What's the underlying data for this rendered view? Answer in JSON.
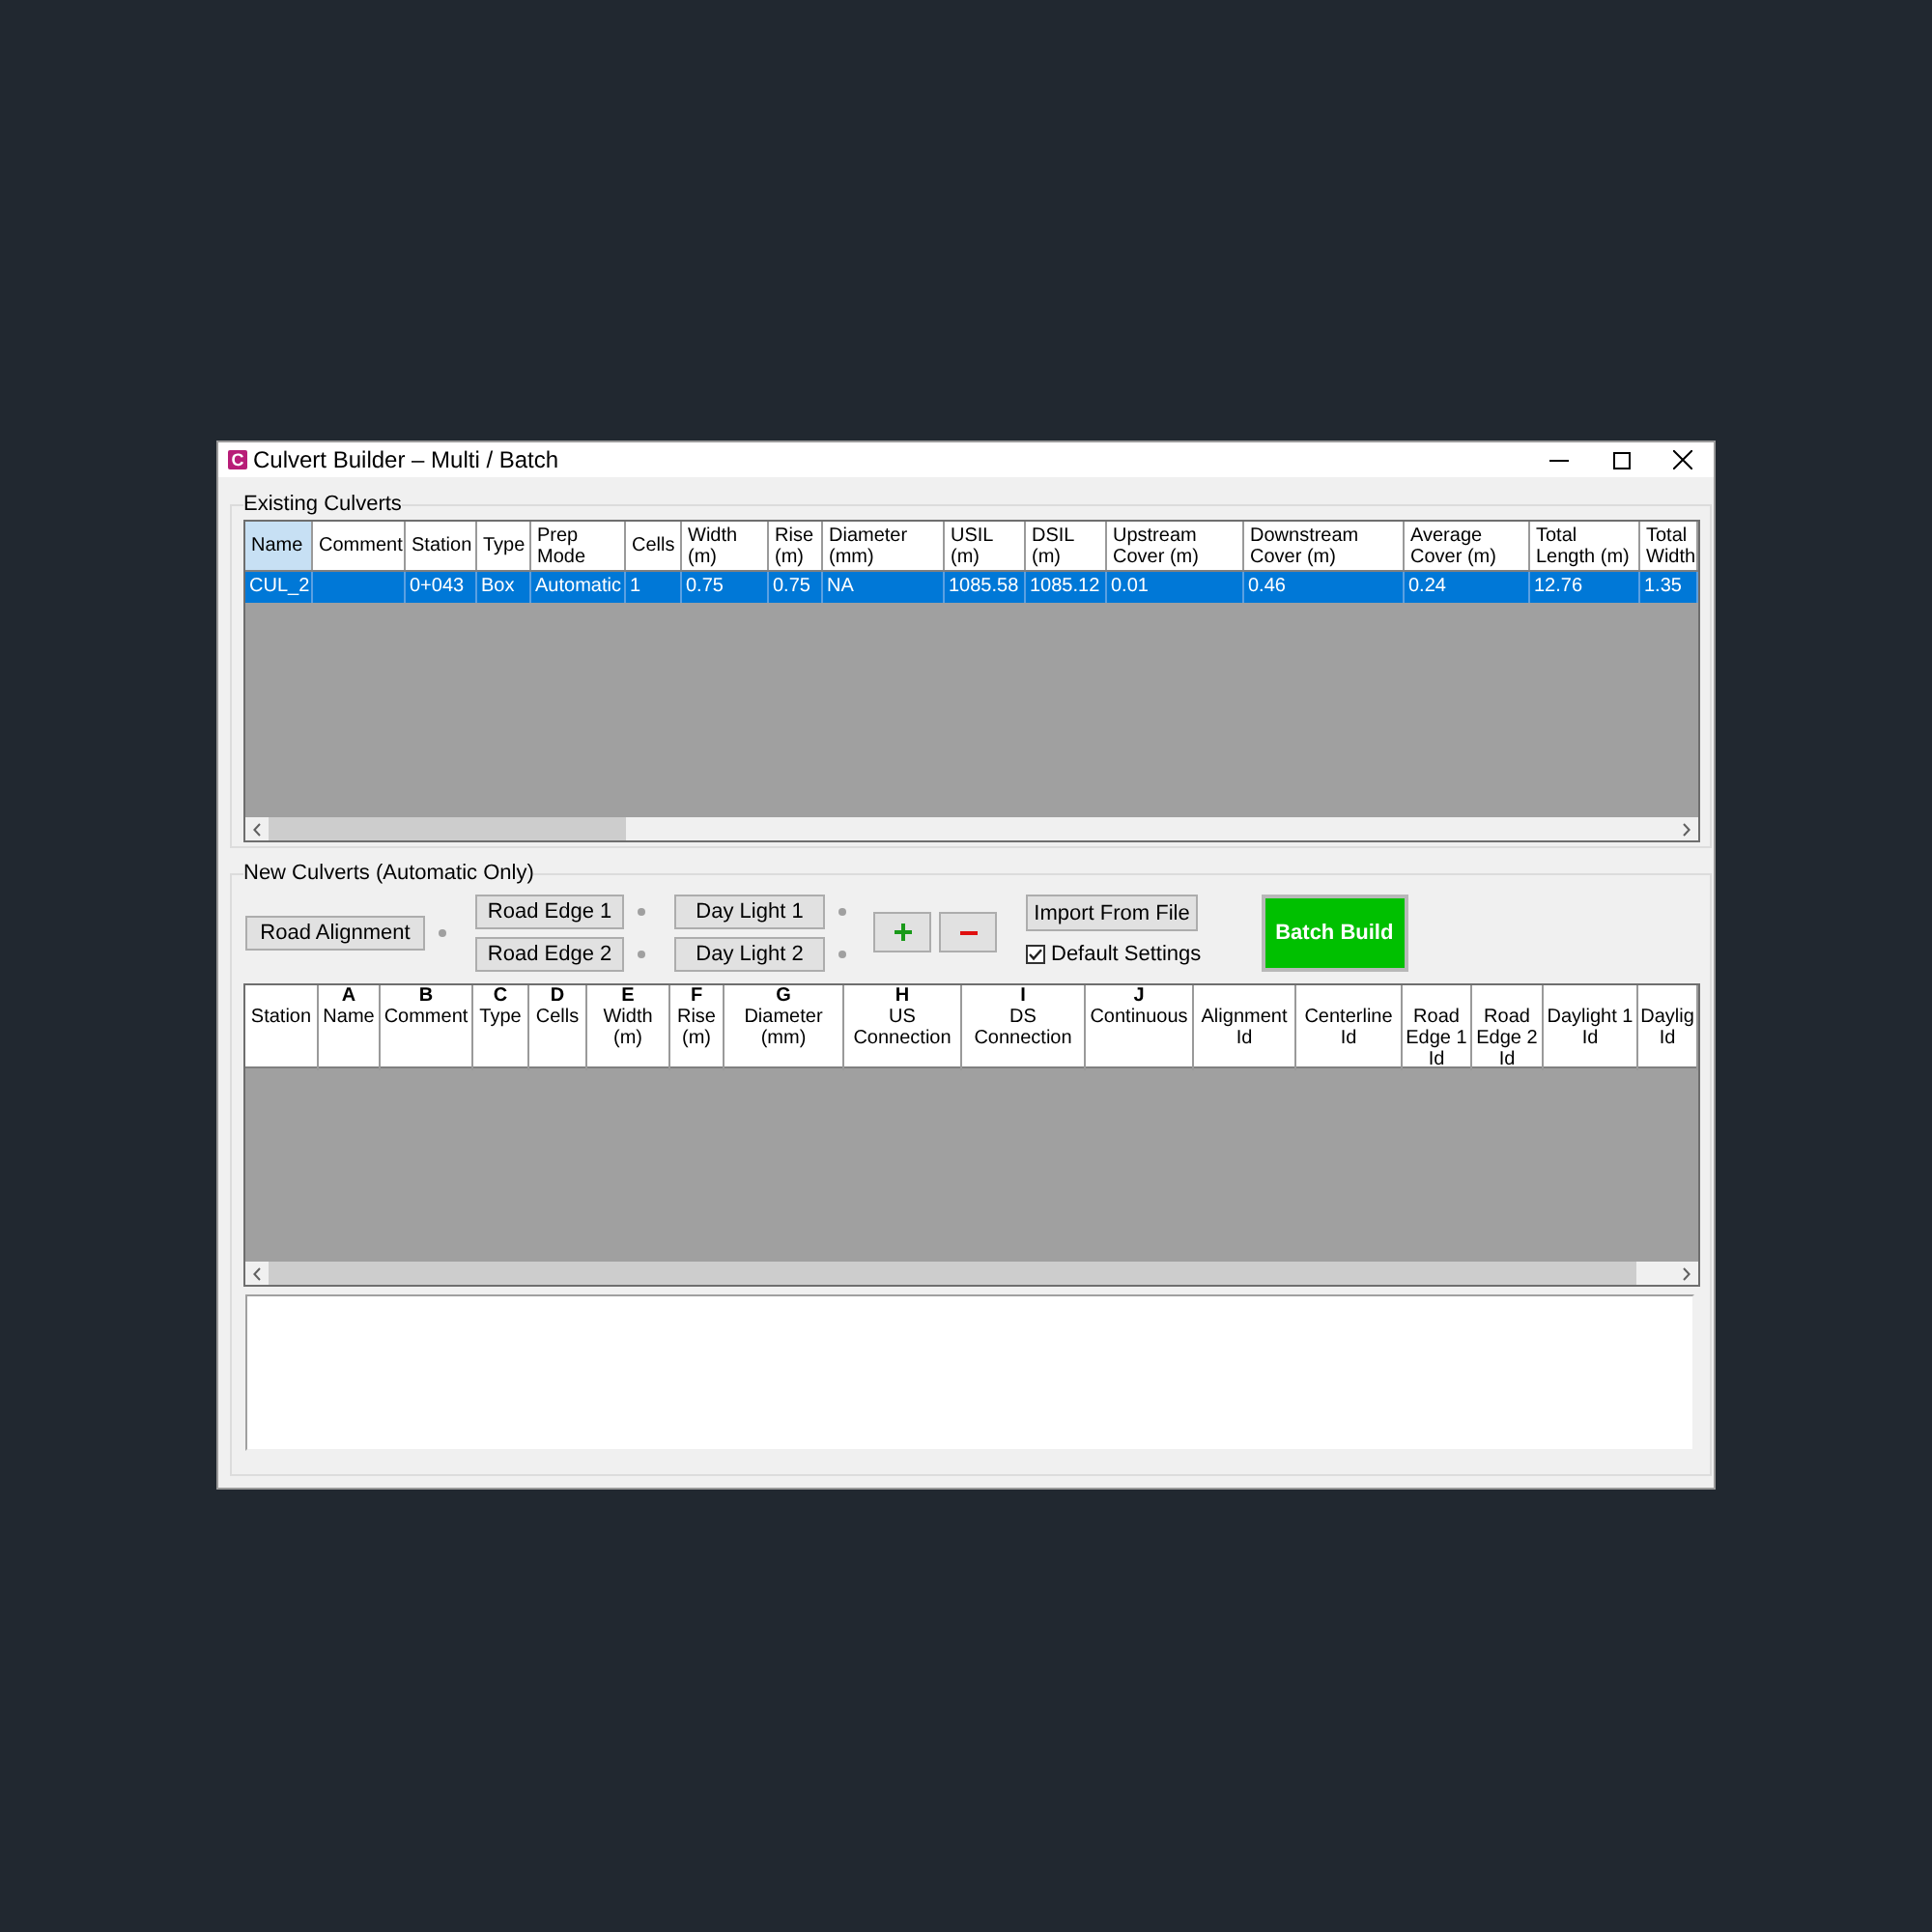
{
  "window": {
    "logo": "C",
    "title": "Culvert Builder – Multi / Batch"
  },
  "existing_culverts": {
    "title": "Existing Culverts",
    "columns": [
      {
        "label": "Name",
        "selected": true
      },
      {
        "label": "Comment",
        "selected": false
      },
      {
        "label": "Station",
        "selected": false
      },
      {
        "label": "Type",
        "selected": false
      },
      {
        "label": "Prep Mode",
        "selected": false
      },
      {
        "label": "Cells",
        "selected": false
      },
      {
        "label": "Width (m)",
        "selected": false
      },
      {
        "label": "Rise (m)",
        "selected": false
      },
      {
        "label": "Diameter (mm)",
        "selected": false
      },
      {
        "label": "USIL (m)",
        "selected": false
      },
      {
        "label": "DSIL (m)",
        "selected": false
      },
      {
        "label": "Upstream Cover (m)",
        "selected": false
      },
      {
        "label": "Downstream Cover (m)",
        "selected": false
      },
      {
        "label": "Average Cover (m)",
        "selected": false
      },
      {
        "label": "Total Length (m)",
        "selected": false
      },
      {
        "label": "Total Width",
        "selected": false
      }
    ],
    "rows": [
      {
        "selected": true,
        "cells": [
          "CUL_2",
          null,
          "0+043",
          "Box",
          "Automatic",
          "1",
          "0.75",
          "0.75",
          "NA",
          "1085.58",
          "1085.12",
          "0.01",
          "0.46",
          "0.24",
          "12.76",
          "1.35"
        ]
      }
    ]
  },
  "new_culverts": {
    "title": "New Culverts (Automatic Only)",
    "selector_groups": [
      [
        "Road Alignment"
      ],
      [
        "Road Edge 1",
        "Road Edge 2"
      ],
      [
        "Day Light 1",
        "Day Light 2"
      ]
    ],
    "import_button": "Import From File",
    "default_settings": {
      "label": "Default Settings",
      "checked": true
    },
    "batch_build_button": "Batch Build",
    "columns": [
      {
        "label": "Station"
      },
      {
        "letter": "A",
        "label": "Name"
      },
      {
        "letter": "B",
        "label": "Comment"
      },
      {
        "letter": "C",
        "label": "Type"
      },
      {
        "letter": "D",
        "label": "Cells"
      },
      {
        "letter": "E",
        "label": "Width (m)"
      },
      {
        "letter": "F",
        "label": "Rise (m)"
      },
      {
        "letter": "G",
        "label": "Diameter (mm)"
      },
      {
        "letter": "H",
        "label": "US Connection"
      },
      {
        "letter": "I",
        "label": "DS Connection"
      },
      {
        "letter": "J",
        "label": "Continuous"
      },
      {
        "label": "Alignment Id"
      },
      {
        "label": "Centerline Id"
      },
      {
        "label": "Road Edge 1 Id"
      },
      {
        "label": "Road Edge 2 Id"
      },
      {
        "label": "Daylight 1 Id"
      },
      {
        "label": "Daylig Id"
      }
    ]
  }
}
